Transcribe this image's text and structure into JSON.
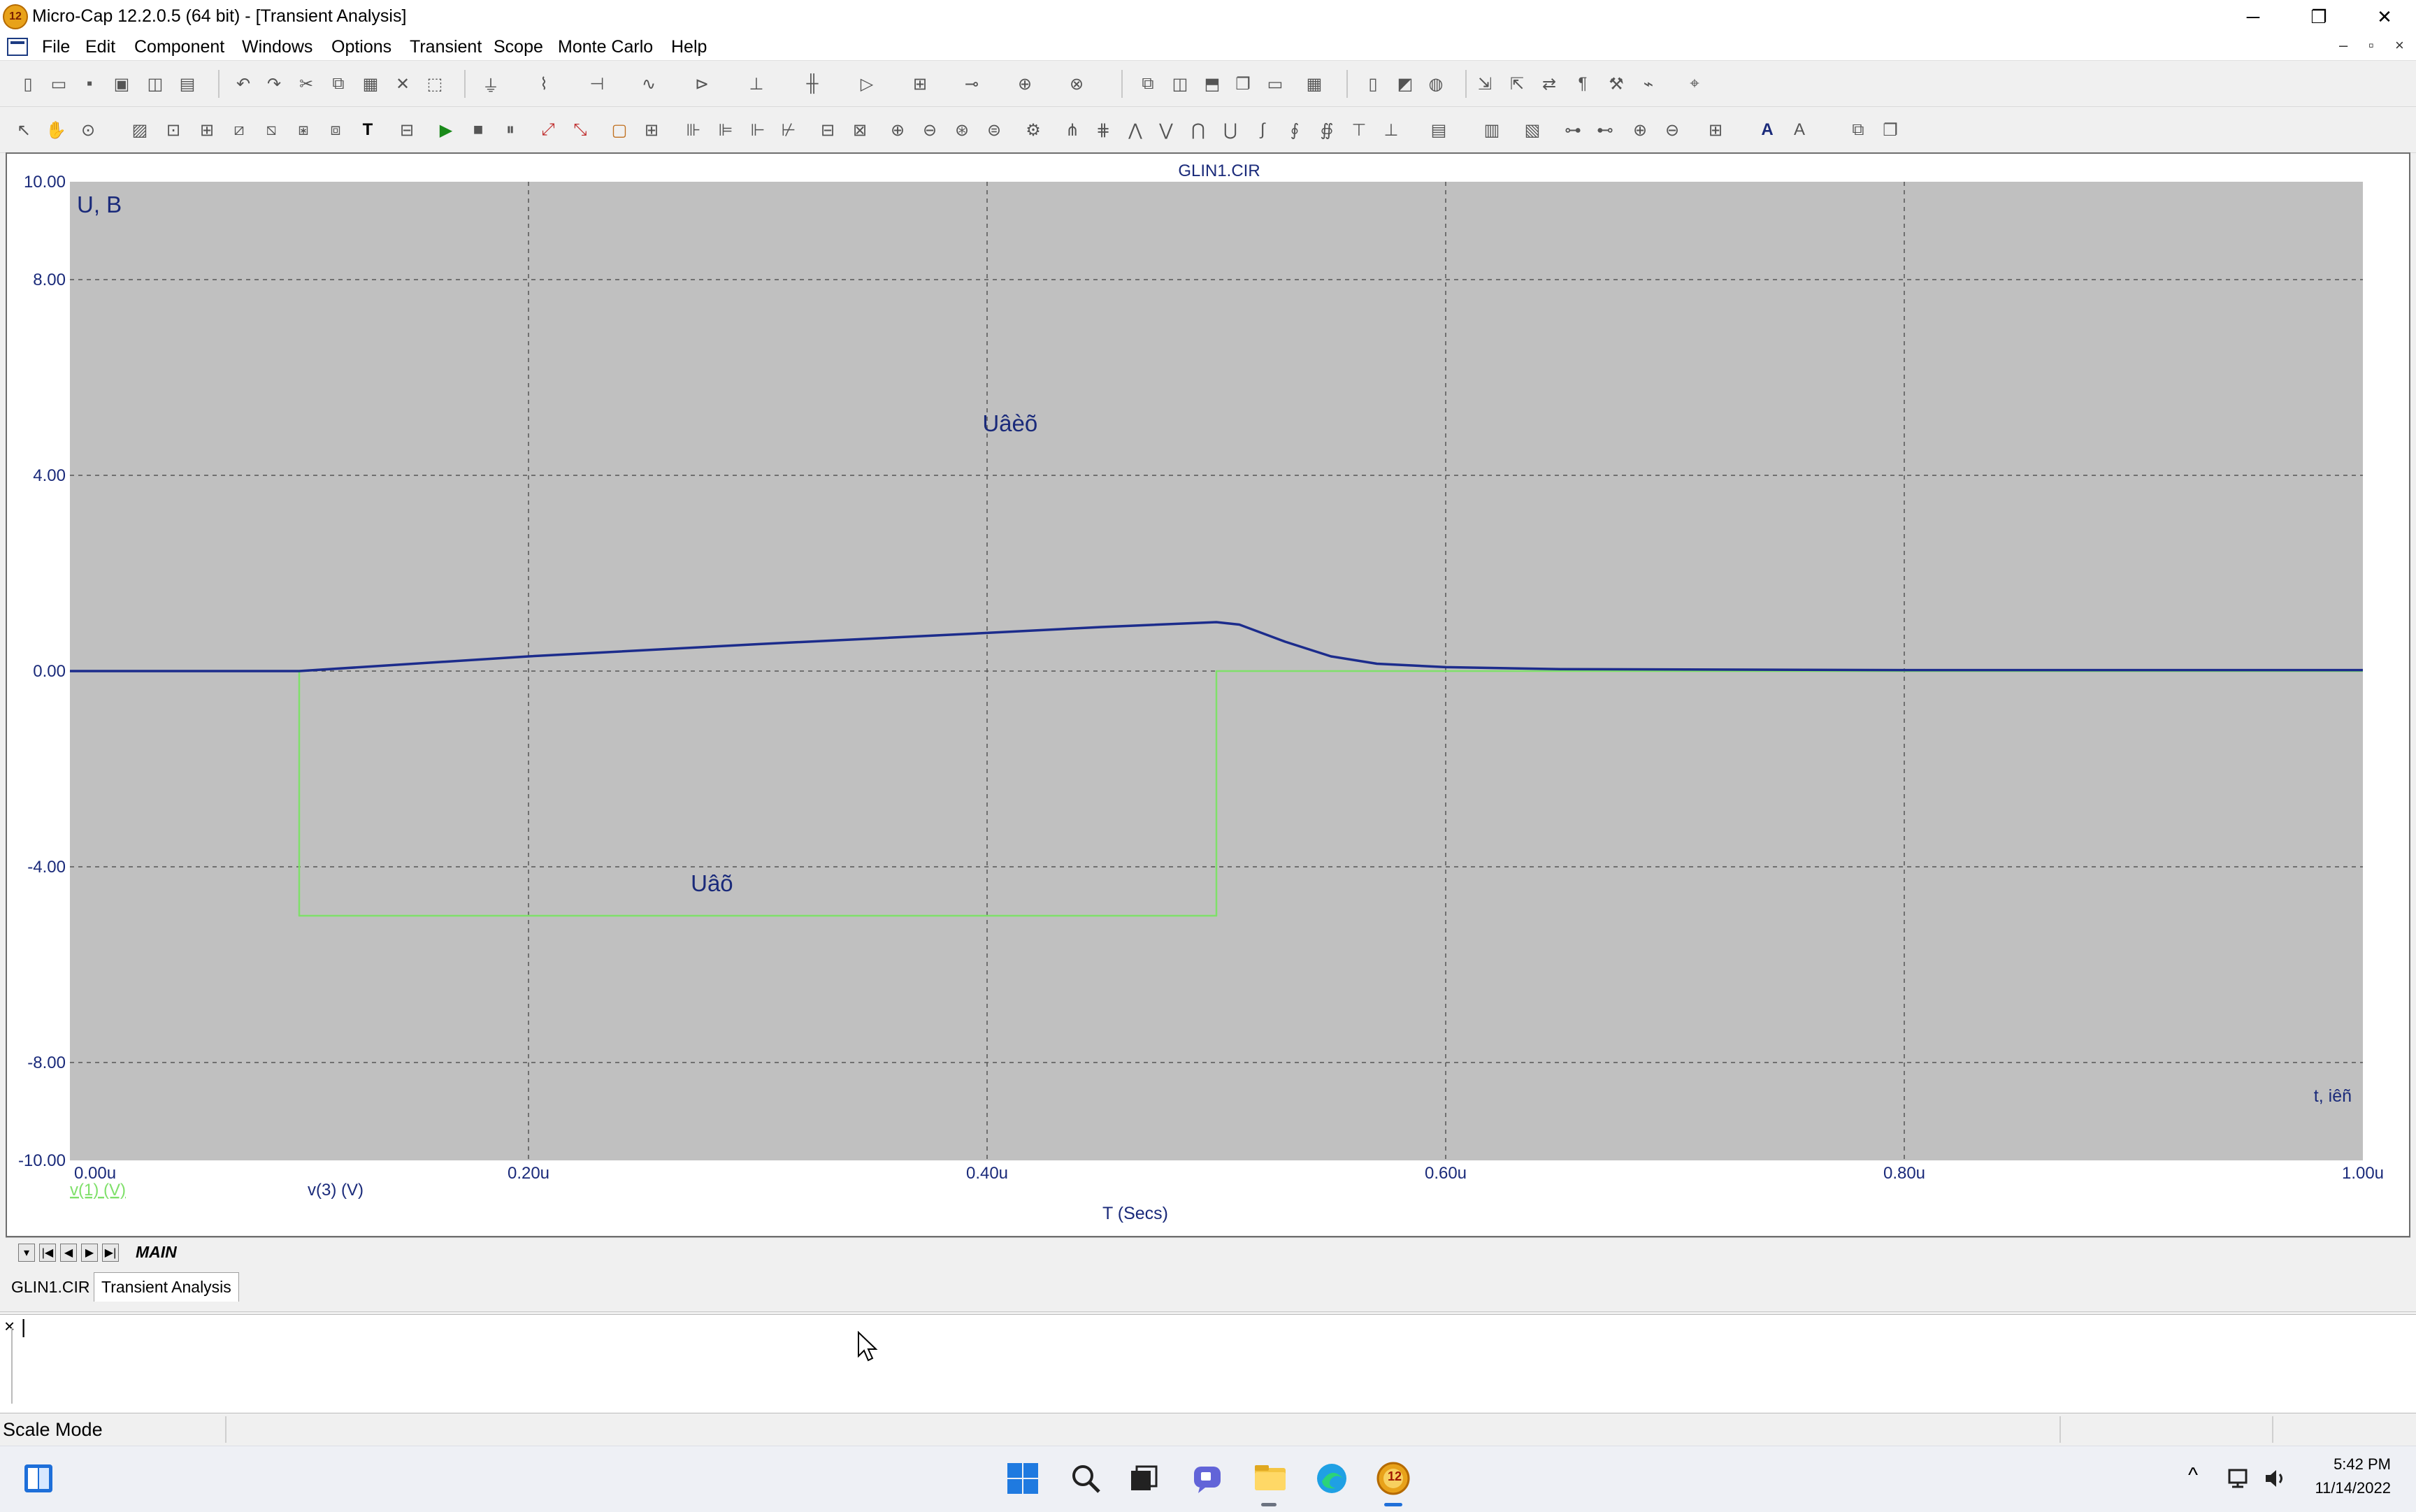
{
  "window": {
    "title": "Micro-Cap 12.2.0.5 (64 bit) - [Transient Analysis]",
    "app_icon_text": "12",
    "minimize": "─",
    "restore": "❐",
    "close": "✕"
  },
  "menu": {
    "items": [
      "File",
      "Edit",
      "Component",
      "Windows",
      "Options",
      "Transient",
      "Scope",
      "Monte Carlo",
      "Help"
    ],
    "mdi_min": "–",
    "mdi_restore": "▫",
    "mdi_close": "×"
  },
  "chart_data": {
    "type": "line",
    "title": "GLIN1.CIR",
    "y_unit_label": "U, B",
    "x_unit_label": "t, iêñ",
    "xlabel": "T (Secs)",
    "xlim": [
      0,
      1.0
    ],
    "ylim": [
      -10,
      10
    ],
    "grid": true,
    "x_ticks": [
      "0.00u",
      "0.20u",
      "0.40u",
      "0.60u",
      "0.80u",
      "1.00u"
    ],
    "y_ticks": [
      "10.00",
      "8.00",
      "4.00",
      "0.00",
      "-4.00",
      "-8.00",
      "-10.00"
    ],
    "annotations": [
      {
        "text": "Uâèõ",
        "x": 0.41,
        "y": 4.9
      },
      {
        "text": "Uâõ",
        "x": 0.28,
        "y": -4.5
      }
    ],
    "series": [
      {
        "name": "v(1) (V)",
        "color": "#7fe06a",
        "x": [
          0.0,
          0.1,
          0.1,
          0.5,
          0.5,
          1.0
        ],
        "y": [
          0.0,
          0.0,
          -5.0,
          -5.0,
          0.0,
          0.0
        ]
      },
      {
        "name": "v(3) (V)",
        "color": "#1c2c8c",
        "x": [
          0.0,
          0.1,
          0.2,
          0.3,
          0.4,
          0.45,
          0.5,
          0.51,
          0.53,
          0.55,
          0.57,
          0.6,
          0.65,
          0.8,
          1.0
        ],
        "y": [
          0.0,
          0.0,
          0.3,
          0.55,
          0.78,
          0.9,
          1.0,
          0.95,
          0.6,
          0.3,
          0.15,
          0.08,
          0.04,
          0.02,
          0.02
        ]
      }
    ]
  },
  "sheet_tabs": {
    "nav": [
      "▾",
      "|◀",
      "◀",
      "▶",
      "▶|"
    ],
    "active": "MAIN"
  },
  "doc_tabs": [
    "GLIN1.CIR",
    "Transient Analysis"
  ],
  "command": {
    "close": "×",
    "cursor": "|"
  },
  "status": {
    "mode": "Scale Mode"
  },
  "taskbar": {
    "time": "5:42 PM",
    "date": "11/14/2022",
    "microcap_badge": "12",
    "tray_up": "^"
  }
}
